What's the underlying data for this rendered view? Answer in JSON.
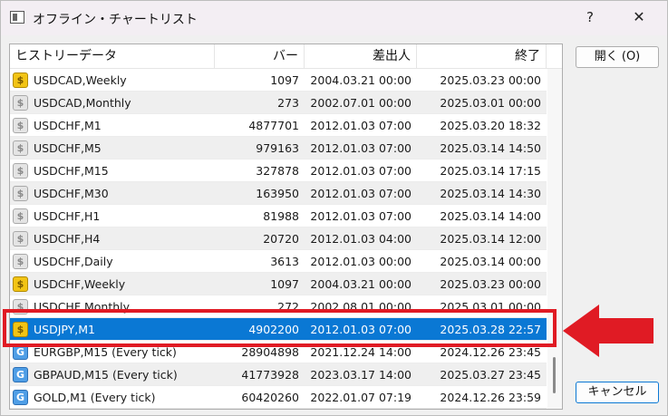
{
  "window": {
    "title": "オフライン・チャートリスト",
    "help": "?",
    "close": "✕"
  },
  "table": {
    "headers": [
      "ヒストリーデータ",
      "バー",
      "差出人",
      "終了"
    ],
    "rows": [
      {
        "icon": "gold",
        "symbol": "USDCAD,Weekly",
        "bars": "1097",
        "from": "2004.03.21 00:00",
        "to": "2025.03.23 00:00"
      },
      {
        "icon": "grey",
        "symbol": "USDCAD,Monthly",
        "bars": "273",
        "from": "2002.07.01 00:00",
        "to": "2025.03.01 00:00"
      },
      {
        "icon": "grey",
        "symbol": "USDCHF,M1",
        "bars": "4877701",
        "from": "2012.01.03 07:00",
        "to": "2025.03.20 18:32"
      },
      {
        "icon": "grey",
        "symbol": "USDCHF,M5",
        "bars": "979163",
        "from": "2012.01.03 07:00",
        "to": "2025.03.14 14:50"
      },
      {
        "icon": "grey",
        "symbol": "USDCHF,M15",
        "bars": "327878",
        "from": "2012.01.03 07:00",
        "to": "2025.03.14 17:15"
      },
      {
        "icon": "grey",
        "symbol": "USDCHF,M30",
        "bars": "163950",
        "from": "2012.01.03 07:00",
        "to": "2025.03.14 14:30"
      },
      {
        "icon": "grey",
        "symbol": "USDCHF,H1",
        "bars": "81988",
        "from": "2012.01.03 07:00",
        "to": "2025.03.14 14:00"
      },
      {
        "icon": "grey",
        "symbol": "USDCHF,H4",
        "bars": "20720",
        "from": "2012.01.03 04:00",
        "to": "2025.03.14 12:00"
      },
      {
        "icon": "grey",
        "symbol": "USDCHF,Daily",
        "bars": "3613",
        "from": "2012.01.03 00:00",
        "to": "2025.03.14 00:00"
      },
      {
        "icon": "gold",
        "symbol": "USDCHF,Weekly",
        "bars": "1097",
        "from": "2004.03.21 00:00",
        "to": "2025.03.23 00:00"
      },
      {
        "icon": "grey",
        "symbol": "USDCHF,Monthly",
        "bars": "272",
        "from": "2002.08.01 00:00",
        "to": "2025.03.01 00:00"
      },
      {
        "icon": "gold",
        "symbol": "USDJPY,M1",
        "bars": "4902200",
        "from": "2012.01.03 07:00",
        "to": "2025.03.28 22:57",
        "selected": true
      },
      {
        "icon": "blue",
        "symbol": "EURGBP,M15 (Every tick)",
        "bars": "28904898",
        "from": "2021.12.24 14:00",
        "to": "2024.12.26 23:45"
      },
      {
        "icon": "blue",
        "symbol": "GBPAUD,M15 (Every tick)",
        "bars": "41773928",
        "from": "2023.03.17 14:00",
        "to": "2025.03.27 23:45"
      },
      {
        "icon": "blue",
        "symbol": "GOLD,M1 (Every tick)",
        "bars": "60420260",
        "from": "2022.01.07 07:19",
        "to": "2024.12.26 23:59"
      }
    ],
    "icon_glyphs": {
      "gold": "$",
      "grey": "$",
      "blue": "G"
    }
  },
  "buttons": {
    "open": "開く (O)",
    "cancel": "キャンセル"
  },
  "colors": {
    "selection": "#0a78d4",
    "annotation": "#e01b24"
  }
}
